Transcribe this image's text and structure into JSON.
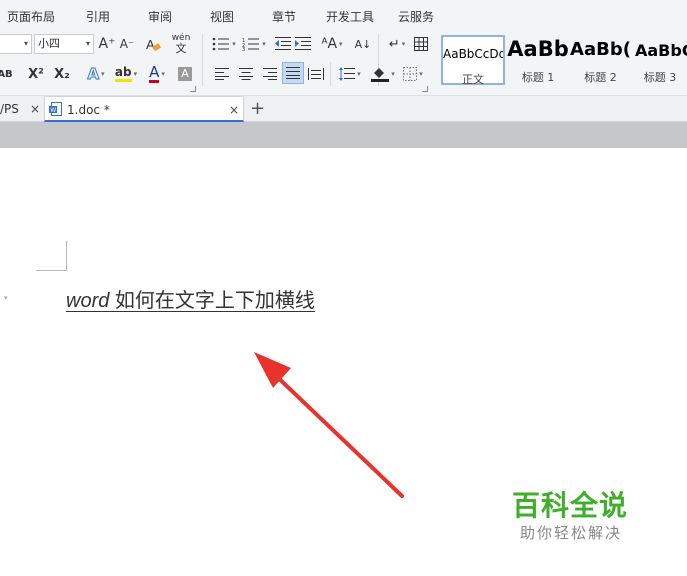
{
  "menu": {
    "items": [
      "页面布局",
      "引用",
      "审阅",
      "视图",
      "章节",
      "开发工具",
      "云服务"
    ]
  },
  "ribbon": {
    "font_size_value": "小四",
    "increase_font_label": "A⁺",
    "decrease_font_label": "A⁻",
    "clear_format_label": "A",
    "phonetic_label": "wén",
    "phonetic_sub_label": "文",
    "superscript_label": "X²",
    "subscript_label": "X₂",
    "strike_label": "AB",
    "text_effect_label": "A",
    "highlight_label": "ab",
    "font_color_label": "A",
    "char_shading_label": "A",
    "sort_label": "A↓",
    "font_color_accent": "#d0021b",
    "highlight_accent": "#f5e000",
    "styles": [
      {
        "preview": "AaBbCcDd",
        "label": "正文"
      },
      {
        "preview": "AaBb",
        "label": "标题 1"
      },
      {
        "preview": "AaBb(",
        "label": "标题 2"
      },
      {
        "preview": "AaBbC",
        "label": "标题 3"
      }
    ]
  },
  "tabs": {
    "wps_label": "/PS",
    "doc_label": "1.doc *",
    "new_tab_label": "+",
    "close_glyph": "×"
  },
  "document": {
    "text_en": "word",
    "text_cn": " 如何在文字上下加横线"
  },
  "annotation": {
    "arrow_color": "#e8322b"
  },
  "watermark": {
    "title": "百科全说",
    "subtitle": "助你轻松解决",
    "color": "#3fae2a"
  }
}
